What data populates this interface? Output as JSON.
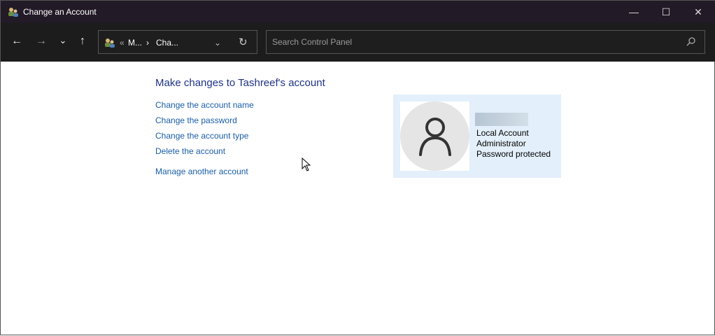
{
  "window": {
    "title": "Change an Account",
    "minimize": "—",
    "maximize": "☐",
    "close": "✕"
  },
  "toolbar": {
    "back": "←",
    "forward": "→",
    "recent": "⌄",
    "up": "↑",
    "breadcrumb_overflow": "«",
    "crumb1": "M...",
    "sep": "›",
    "crumb2": "Cha...",
    "dropdown": "⌄",
    "refresh": "↻",
    "search_placeholder": "Search Control Panel"
  },
  "main": {
    "heading": "Make changes to Tashreef's account",
    "links": [
      "Change the account name",
      "Change the password",
      "Change the account type",
      "Delete the account"
    ],
    "manage_link": "Manage another account"
  },
  "account": {
    "type": "Local Account",
    "role": "Administrator",
    "status": "Password protected"
  }
}
